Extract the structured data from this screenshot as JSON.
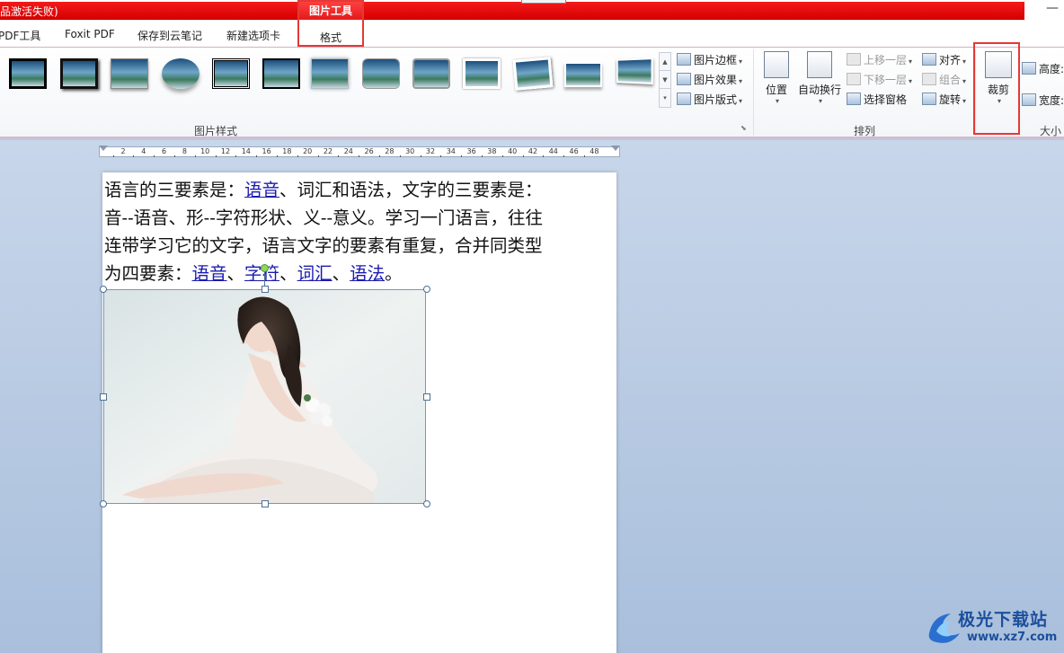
{
  "title_bar": {
    "title": "品激活失败)",
    "minimize": "—"
  },
  "tabs": [
    {
      "label": "PDF工具"
    },
    {
      "label": "Foxit PDF"
    },
    {
      "label": "保存到云笔记"
    },
    {
      "label": "新建选项卡"
    }
  ],
  "context_tool": {
    "group_label": "图片工具",
    "tab_label": "格式"
  },
  "ribbon": {
    "picture_styles": {
      "group_label": "图片样式",
      "border_btn": "图片边框",
      "effects_btn": "图片效果",
      "layout_btn": "图片版式"
    },
    "arrange": {
      "group_label": "排列",
      "position": "位置",
      "wrap_text": "自动换行",
      "bring_forward": "上移一层",
      "send_backward": "下移一层",
      "selection_pane": "选择窗格",
      "align": "对齐",
      "group": "组合",
      "rotate": "旋转"
    },
    "size": {
      "group_label": "大小",
      "crop": "裁剪",
      "height_label": "高度:",
      "width_label": "宽度:"
    }
  },
  "ruler": {
    "ticks": [
      "2",
      "4",
      "6",
      "8",
      "10",
      "12",
      "14",
      "16",
      "18",
      "20",
      "22",
      "24",
      "26",
      "28",
      "30",
      "32",
      "34",
      "36",
      "38",
      "40",
      "42",
      "44",
      "46",
      "48"
    ]
  },
  "document": {
    "line1_pre": "语言的三要素是：",
    "line1_link": "语音",
    "line1_post": "、词汇和语法，文字的三要素是：",
    "line2": "音--语音、形--字符形状、义--意义。学习一门语言，往往",
    "line3": "连带学习它的文字，语言文字的要素有重复，合并同类型",
    "line4_pre": "为四要素：",
    "line4_link1": "语音",
    "line4_sep1": "、",
    "line4_link2": "字符",
    "line4_sep2": "、",
    "line4_link3": "词汇",
    "line4_sep3": "、",
    "line4_link4": "语法",
    "line4_end": "。"
  },
  "watermark": {
    "brand": "极光下载站",
    "url": "www.xz7.com"
  }
}
